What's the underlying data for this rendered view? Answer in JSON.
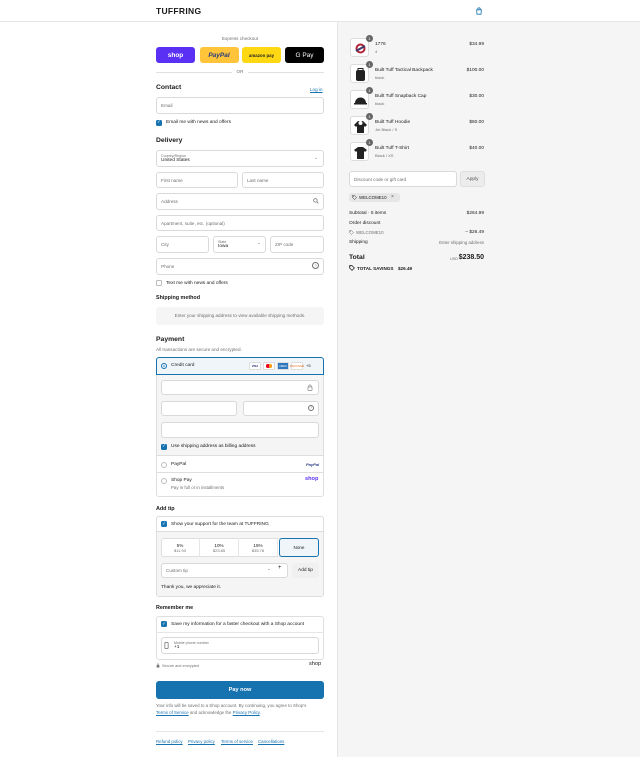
{
  "header": {
    "brand": "TUFFRING",
    "bag_icon": "bag-icon"
  },
  "express": {
    "title": "Express checkout",
    "buttons": [
      {
        "label": "shop",
        "color": "#5a31f4"
      },
      {
        "label": "PayPal",
        "color": "#ffc439"
      },
      {
        "label": "amazon pay",
        "color": "#ffd814"
      },
      {
        "label": "G Pay",
        "color": "#000000"
      }
    ],
    "or": "OR"
  },
  "contact": {
    "title": "Contact",
    "login": "Log in",
    "email_placeholder": "Email",
    "news_label": "Email me with news and offers"
  },
  "delivery": {
    "title": "Delivery",
    "country_label": "Country/Region",
    "country_value": "United States",
    "first_name": "First name",
    "last_name": "Last name",
    "address": "Address",
    "apartment": "Apartment, suite, etc. (optional)",
    "city": "City",
    "state_label": "State",
    "state_value": "Iowa",
    "zip": "ZIP code",
    "phone": "Phone",
    "text_label": "Text me with news and offers"
  },
  "shipping": {
    "title": "Shipping method",
    "notice": "Enter your shipping address to view available shipping methods."
  },
  "payment": {
    "title": "Payment",
    "subtitle": "All transactions are secure and encrypted.",
    "credit_card": "Credit card",
    "cards": [
      "VISA",
      "MC",
      "AMEX",
      "DISCOVER",
      "+5"
    ],
    "billing_label": "Use shipping address as billing address",
    "paypal": "PayPal",
    "paypal_logo": "PayPal",
    "shoppay": "Shop Pay",
    "shoppay_sub": "Pay in full or in installments",
    "shoppay_logo": "shop"
  },
  "tip": {
    "title": "Add tip",
    "support_label": "Show your support for the team at TUFFRING",
    "options": [
      {
        "pct": "5%",
        "amt": "$11.93"
      },
      {
        "pct": "10%",
        "amt": "$23.85"
      },
      {
        "pct": "15%",
        "amt": "$35.78"
      },
      {
        "pct": "None",
        "amt": ""
      }
    ],
    "custom": "Custom tip",
    "add": "Add tip",
    "thanks": "Thank you, we appreciate it."
  },
  "remember": {
    "title": "Remember me",
    "save_label": "Save my information for a faster checkout with a Shop account",
    "phone_label": "Mobile phone number",
    "phone_value": "+1",
    "secure": "Secure and encrypted",
    "shop": "shop"
  },
  "pay": {
    "button": "Pay now",
    "legal1": "Your info will be saved to a Shop account. By continuing, you agree to Shop's",
    "tos": "Terms of Service",
    "legal2": "and acknowledge the",
    "privacy": "Privacy Policy",
    "legal3": "."
  },
  "footer": {
    "links": [
      "Refund policy",
      "Privacy policy",
      "Terms of service",
      "Cancellations"
    ]
  },
  "summary": {
    "items": [
      {
        "name": "1776",
        "variant": "4",
        "price": "$34.99",
        "qty": "1"
      },
      {
        "name": "Built Tuff Tactical Backpack",
        "variant": "black",
        "price": "$100.00",
        "qty": "1"
      },
      {
        "name": "Built Tuff Snapback Cap",
        "variant": "black",
        "price": "$30.00",
        "qty": "1"
      },
      {
        "name": "Built Tuff Hoodie",
        "variant": "Jet Black / S",
        "price": "$60.00",
        "qty": "1"
      },
      {
        "name": "Built Tuff T-Shirt",
        "variant": "Black / XS",
        "price": "$40.00",
        "qty": "1"
      }
    ],
    "discount_placeholder": "Discount code or gift card",
    "apply": "Apply",
    "code_tag": "WELCOME10",
    "subtotal_label": "Subtotal · 5 items",
    "subtotal": "$264.99",
    "order_discount": "Order discount",
    "discount_code": "WELCOME10",
    "discount_amt": "– $26.49",
    "shipping_label": "Shipping",
    "shipping_val": "Enter shipping address",
    "total_label": "Total",
    "currency": "USD",
    "total": "$238.50",
    "savings_label": "TOTAL SAVINGS",
    "savings": "$26.49"
  }
}
